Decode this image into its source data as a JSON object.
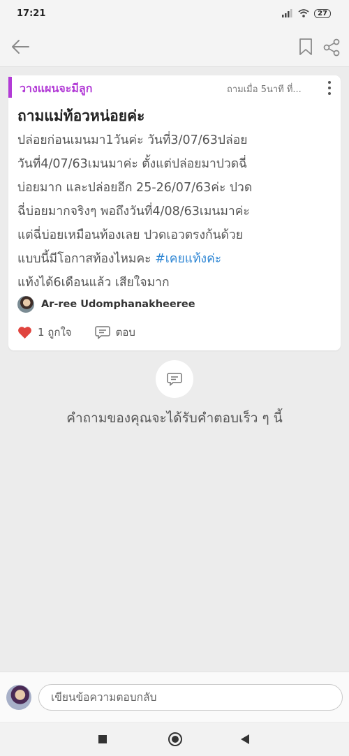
{
  "status_bar": {
    "time": "17:21",
    "battery": "27"
  },
  "app_bar": {
    "icons": [
      "back-arrow-icon",
      "bookmark-icon",
      "share-icon"
    ]
  },
  "question": {
    "category": "วางแผนจะมีลูก",
    "asked_time": "ถามเมื่อ 5นาที ที่...",
    "title": "ถามแม่ท้อวหน่อยค่ะ",
    "lines": [
      "ปล่อยก่อนเมนมา1วันค่ะ วันที่3/07/63ปล่อย",
      "วันที่4/07/63เมนมาค่ะ ตั้งแต่ปล่อยมาปวดฉี่",
      "บ่อยมาก และปล่อยอีก 25-26/07/63ค่ะ ปวด",
      "ฉี่บ่อยมากจริงๆ พอถึงวันที่4/08/63เมนมาค่ะ",
      "แต่ฉี่บ่อยเหมือนท้องเลย ปวดเอวตรงก้นด้วย"
    ],
    "line6_text": "แบบนี้มีโอกาสท้องไหมคะ ",
    "hashtag": "#เคยแท้งค่ะ",
    "line7": "แท้งได้6เดือนแล้ว เสียใจมาก",
    "author": "Ar-ree Udomphanakheeree",
    "likes": "1 ถูกใจ",
    "reply_label": "ตอบ"
  },
  "empty_state": {
    "message": "คำถามของคุณจะได้รับคำตอบเร็ว ๆ นี้"
  },
  "compose": {
    "placeholder": "เขียนข้อความตอบกลับ"
  },
  "colors": {
    "accent": "#b23bd6",
    "hashtag": "#2e86d4",
    "heart": "#e0443e",
    "background": "#ececec"
  }
}
